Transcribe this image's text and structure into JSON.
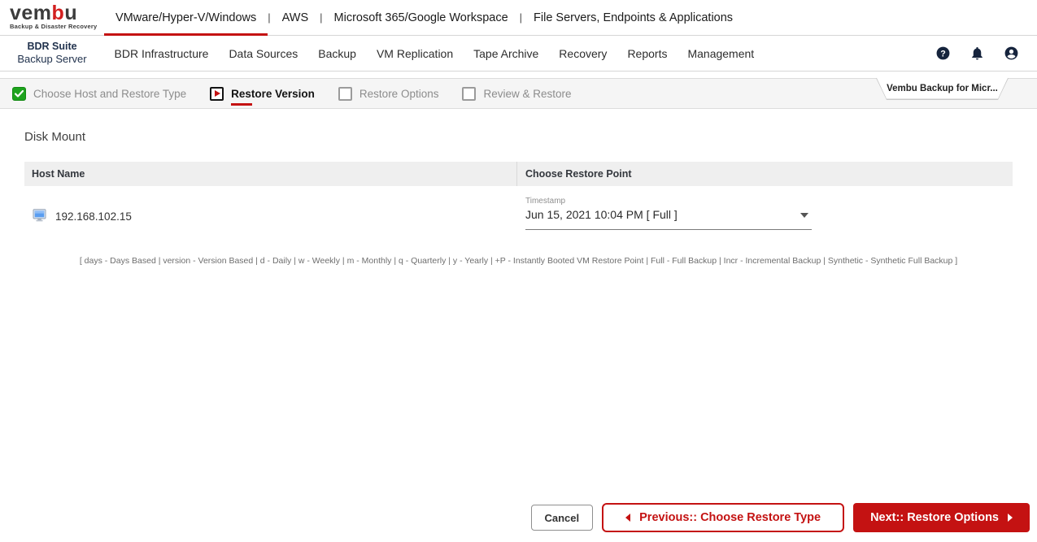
{
  "brand": {
    "logo_parts": [
      "vem",
      "b",
      "u"
    ],
    "logo_tagline": "Backup & Disaster Recovery",
    "accent_red": "#c41212",
    "icon_navy": "#16243d"
  },
  "top_nav": {
    "items": [
      {
        "label": "VMware/Hyper-V/Windows",
        "active": true
      },
      {
        "label": "AWS",
        "active": false
      },
      {
        "label": "Microsoft 365/Google Workspace",
        "active": false
      },
      {
        "label": "File Servers, Endpoints & Applications",
        "active": false
      }
    ]
  },
  "app_bar": {
    "product_name": "BDR Suite",
    "product_sub": "Backup Server",
    "menu": [
      "BDR Infrastructure",
      "Data Sources",
      "Backup",
      "VM Replication",
      "Tape Archive",
      "Recovery",
      "Reports",
      "Management"
    ],
    "icons": [
      "help-icon",
      "notification-bell-icon",
      "user-account-icon"
    ]
  },
  "wizard": {
    "steps": [
      {
        "label": "Choose Host and Restore Type",
        "state": "completed",
        "icon": "green-check-icon"
      },
      {
        "label": "Restore Version",
        "state": "current",
        "icon": "red-play-icon"
      },
      {
        "label": "Restore Options",
        "state": "pending",
        "icon": "empty-checkbox-icon"
      },
      {
        "label": "Review & Restore",
        "state": "pending",
        "icon": "empty-checkbox-icon"
      }
    ],
    "context_tab": "Vembu Backup for Micr..."
  },
  "main": {
    "section_title": "Disk Mount",
    "table": {
      "columns": [
        "Host Name",
        "Choose Restore Point"
      ],
      "rows": [
        {
          "host_icon": "computer-icon",
          "host_name": "192.168.102.15",
          "restore_point": {
            "field_label": "Timestamp",
            "selected_value": "Jun 15, 2021 10:04 PM [ Full ]",
            "dropdown_icon": "caret-down-icon"
          }
        }
      ]
    },
    "legend": "[ days - Days Based | version - Version Based | d - Daily | w - Weekly | m - Monthly | q - Quarterly | y - Yearly | +P - Instantly Booted VM Restore Point | Full - Full Backup | Incr - Incremental Backup | Synthetic - Synthetic Full Backup ]"
  },
  "footer": {
    "cancel_label": "Cancel",
    "previous_label": "Previous:: Choose Restore Type",
    "next_label": "Next:: Restore Options"
  }
}
